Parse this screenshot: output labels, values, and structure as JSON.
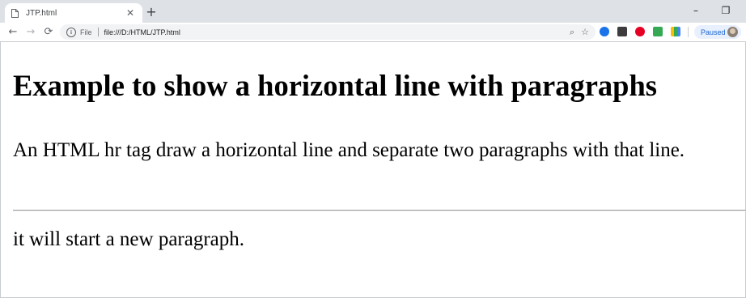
{
  "browser": {
    "tab": {
      "title": "JTP.html",
      "close_glyph": "✕"
    },
    "new_tab_glyph": "+",
    "window_controls": {
      "minimize": "–",
      "restore": "❐"
    },
    "nav": {
      "back": "←",
      "forward": "→",
      "reload": "⟳"
    },
    "address_bar": {
      "scheme_label": "File",
      "url": "file:///D:/HTML/JTP.html",
      "info_glyph": "i",
      "zoom_glyph": "⌕",
      "star_glyph": "☆"
    },
    "extensions": [
      "extension-blue-icon",
      "mail-icon",
      "pinterest-icon",
      "evernote-icon",
      "colorful-extension-icon"
    ],
    "profile": {
      "status": "Paused"
    }
  },
  "page": {
    "heading": "Example to show a horizontal line with paragraphs",
    "paragraph_1": "An HTML hr tag draw a horizontal line and separate two paragraphs with that line.",
    "paragraph_2": "it will start a new paragraph."
  }
}
